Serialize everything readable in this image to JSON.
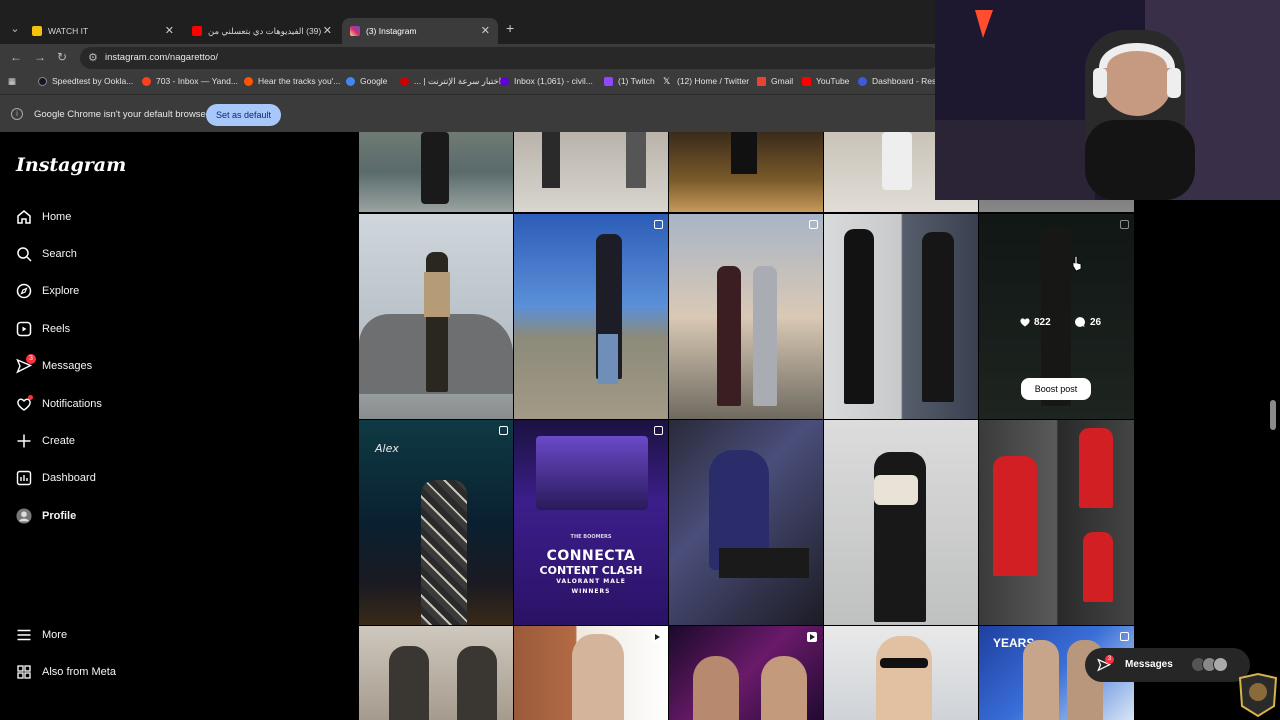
{
  "browser": {
    "tabs": [
      {
        "title": "WATCH IT",
        "favicon_color": "#f4c20d"
      },
      {
        "title": "(39) الفيديوهات دي بتعسلني من",
        "favicon_color": "#ff0000"
      },
      {
        "title": "(3) Instagram",
        "favicon_color": "#d62976"
      }
    ],
    "url": "instagram.com/nagarettoo/",
    "bookmarks": [
      {
        "label": "Speedtest by Ookla...",
        "color": "#141526"
      },
      {
        "label": "703 - Inbox — Yand...",
        "color": "#fc3f1d"
      },
      {
        "label": "Hear the tracks you'...",
        "color": "#ff5500"
      },
      {
        "label": "Google",
        "color": "#4285f4"
      },
      {
        "label": "اختبار سرعة الإنترنت | ...",
        "color": "#cc0000"
      },
      {
        "label": "Inbox (1,061) - civil...",
        "color": "#6001d2"
      },
      {
        "label": "(1) Twitch",
        "color": "#9146ff"
      },
      {
        "label": "(12) Home / Twitter",
        "color": "#ffffff"
      },
      {
        "label": "Gmail",
        "color": "#ea4335"
      },
      {
        "label": "YouTube",
        "color": "#ff0000"
      },
      {
        "label": "Dashboard - Rest",
        "color": "#3b5bdb"
      }
    ],
    "infobar": {
      "message": "Google Chrome isn't your default browser",
      "button": "Set as default"
    }
  },
  "instagram": {
    "logo": "Instagram",
    "nav": [
      {
        "label": "Home",
        "icon": "home-icon"
      },
      {
        "label": "Search",
        "icon": "search-icon"
      },
      {
        "label": "Explore",
        "icon": "compass-icon"
      },
      {
        "label": "Reels",
        "icon": "reels-icon"
      },
      {
        "label": "Messages",
        "icon": "messenger-icon",
        "badge": "3"
      },
      {
        "label": "Notifications",
        "icon": "heart-icon"
      },
      {
        "label": "Create",
        "icon": "plus-icon"
      },
      {
        "label": "Dashboard",
        "icon": "chart-icon"
      },
      {
        "label": "Profile",
        "icon": "avatar-icon"
      }
    ],
    "bottom_nav": [
      {
        "label": "More",
        "icon": "menu-icon"
      },
      {
        "label": "Also from Meta",
        "icon": "meta-icon"
      }
    ],
    "hovered_post": {
      "likes": "822",
      "comments": "26",
      "boost_label": "Boost post"
    },
    "post_text": {
      "alex": "Alex",
      "poster_line1": "CONNECTA",
      "poster_line2": "CONTENT CLASH",
      "poster_line3": "VALORANT MALE",
      "poster_line4": "WINNERS",
      "poster_brand": "THE BOOMERS",
      "years": "YEARS"
    },
    "messages_pill": {
      "label": "Messages",
      "badge": "3"
    }
  },
  "colors": {
    "accent_blue": "#a8c7fa",
    "notification_red": "#ff3040"
  }
}
